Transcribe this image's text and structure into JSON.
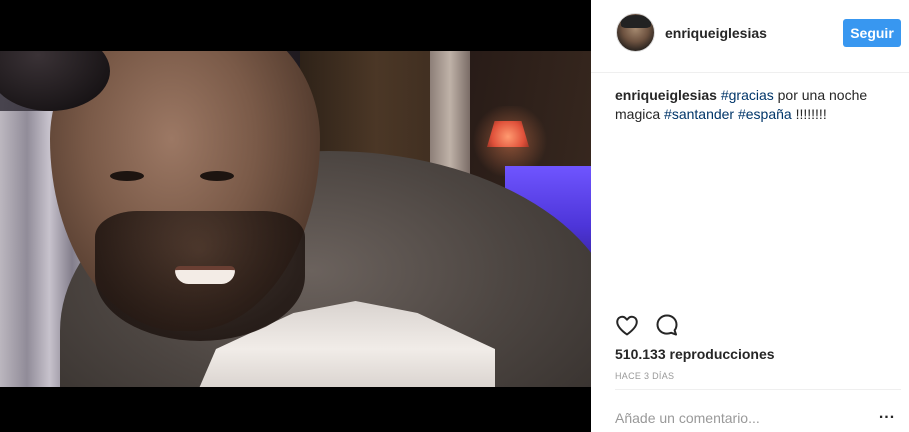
{
  "post": {
    "username": "enriqueiglesias",
    "follow_label": "Seguir",
    "caption": {
      "user": "enriqueiglesias",
      "parts": [
        {
          "type": "tag",
          "text": "#gracias"
        },
        {
          "type": "text",
          "text": " por una noche magica "
        },
        {
          "type": "tag",
          "text": "#santander"
        },
        {
          "type": "text",
          "text": " "
        },
        {
          "type": "tag",
          "text": "#españa"
        },
        {
          "type": "text",
          "text": " !!!!!!!!"
        }
      ]
    },
    "views": "510.133 reproducciones",
    "timestamp": "HACE 3 DÍAS",
    "comment_placeholder": "Añade un comentario...",
    "more_label": "..."
  },
  "icons": {
    "like": "heart-outline-icon",
    "comment": "speech-bubble-icon"
  },
  "colors": {
    "accent": "#3897f0",
    "hashtag": "#003569",
    "text": "#262626",
    "muted": "#999999"
  }
}
